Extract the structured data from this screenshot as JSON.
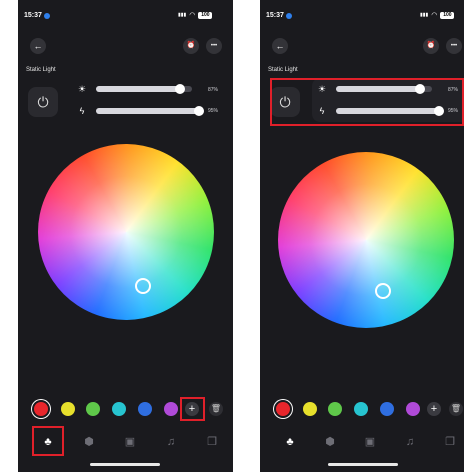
{
  "status": {
    "time": "15:37",
    "battery": "100"
  },
  "screen": {
    "title": "Static Light"
  },
  "brightness": {
    "value": 0.87,
    "label": "87%"
  },
  "power_level": {
    "value": 0.95,
    "label": "95%"
  },
  "swatches": [
    "#e8262c",
    "#e7e02c",
    "#5fc84a",
    "#27c4d0",
    "#2f6ee0",
    "#b04ad8"
  ],
  "icons": {
    "back": "arrow-left-icon",
    "timer": "alarm-clock-icon",
    "more": "more-icon",
    "power": "power-icon",
    "sun": "sun-icon",
    "bolt": "lightning-icon",
    "add": "plus-icon",
    "delete": "trash-icon"
  },
  "glyphs": {
    "back": "←",
    "timer": "⏰",
    "more": "•••",
    "power": "⏻",
    "sun": "☀",
    "bolt": "ϟ",
    "plus": "+",
    "trash": "🗑",
    "signal": "▮▮▮",
    "wifi": "◠",
    "tab_scene": "♣",
    "tab_shield": "⬢",
    "tab_box": "▣",
    "tab_music": "♫",
    "tab_copy": "❐"
  },
  "highlight_color": "#e0202a"
}
